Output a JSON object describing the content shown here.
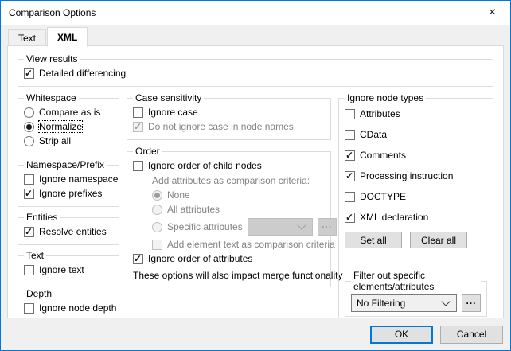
{
  "window": {
    "title": "Comparison Options",
    "close_glyph": "×"
  },
  "tabs": {
    "items": [
      {
        "label": "Text",
        "active": false
      },
      {
        "label": "XML",
        "active": true
      }
    ]
  },
  "colors": {
    "accent": "#0078d7",
    "window_bg": "#f0f0f0",
    "page_bg": "#ffffff",
    "group_border": "#dcdcdc",
    "disabled_text": "#838383"
  },
  "view_results": {
    "title": "View results",
    "detailed": {
      "label": "Detailed differencing",
      "checked": true
    }
  },
  "whitespace": {
    "title": "Whitespace",
    "options": [
      {
        "label": "Compare as is",
        "selected": false
      },
      {
        "label": "Normalize",
        "selected": true,
        "focused": true
      },
      {
        "label": "Strip all",
        "selected": false
      }
    ]
  },
  "namespace_prefix": {
    "title": "Namespace/Prefix",
    "options": [
      {
        "label": "Ignore namespace",
        "checked": false
      },
      {
        "label": "Ignore prefixes",
        "checked": true
      }
    ]
  },
  "entities": {
    "title": "Entities",
    "option": {
      "label": "Resolve entities",
      "checked": true
    }
  },
  "text_group": {
    "title": "Text",
    "option": {
      "label": "Ignore text",
      "checked": false
    }
  },
  "depth": {
    "title": "Depth",
    "option": {
      "label": "Ignore node depth",
      "checked": false
    }
  },
  "case_sensitivity": {
    "title": "Case sensitivity",
    "ignore_case": {
      "label": "Ignore case",
      "checked": false
    },
    "node_names": {
      "label": "Do not ignore case in node names",
      "checked": true,
      "disabled": true
    }
  },
  "order": {
    "title": "Order",
    "ignore_child": {
      "label": "Ignore order of child nodes",
      "checked": false
    },
    "add_attr_label": "Add attributes as comparison criteria:",
    "radio_none": {
      "label": "None",
      "selected": true,
      "disabled": true
    },
    "radio_all": {
      "label": "All attributes",
      "selected": false,
      "disabled": true
    },
    "radio_specific": {
      "label": "Specific attributes",
      "selected": false,
      "disabled": true
    },
    "specific_combo": {
      "value": "",
      "disabled": true
    },
    "browse_label": "...",
    "element_text": {
      "label": "Add element text as comparison criteria",
      "checked": false,
      "disabled": true
    },
    "ignore_attr_order": {
      "label": "Ignore order of attributes",
      "checked": true
    },
    "note": "These options will also impact merge functionality"
  },
  "ignore_node_types": {
    "title": "Ignore node types",
    "items": [
      {
        "label": "Attributes",
        "checked": false
      },
      {
        "label": "CData",
        "checked": false
      },
      {
        "label": "Comments",
        "checked": true
      },
      {
        "label": "Processing instruction",
        "checked": true
      },
      {
        "label": "DOCTYPE",
        "checked": false
      },
      {
        "label": "XML declaration",
        "checked": true
      }
    ],
    "set_all": "Set all",
    "clear_all": "Clear all"
  },
  "filter": {
    "title": "Filter out specific elements/attributes",
    "value": "No Filtering",
    "browse_label": "..."
  },
  "footer": {
    "ok": "OK",
    "cancel": "Cancel"
  }
}
